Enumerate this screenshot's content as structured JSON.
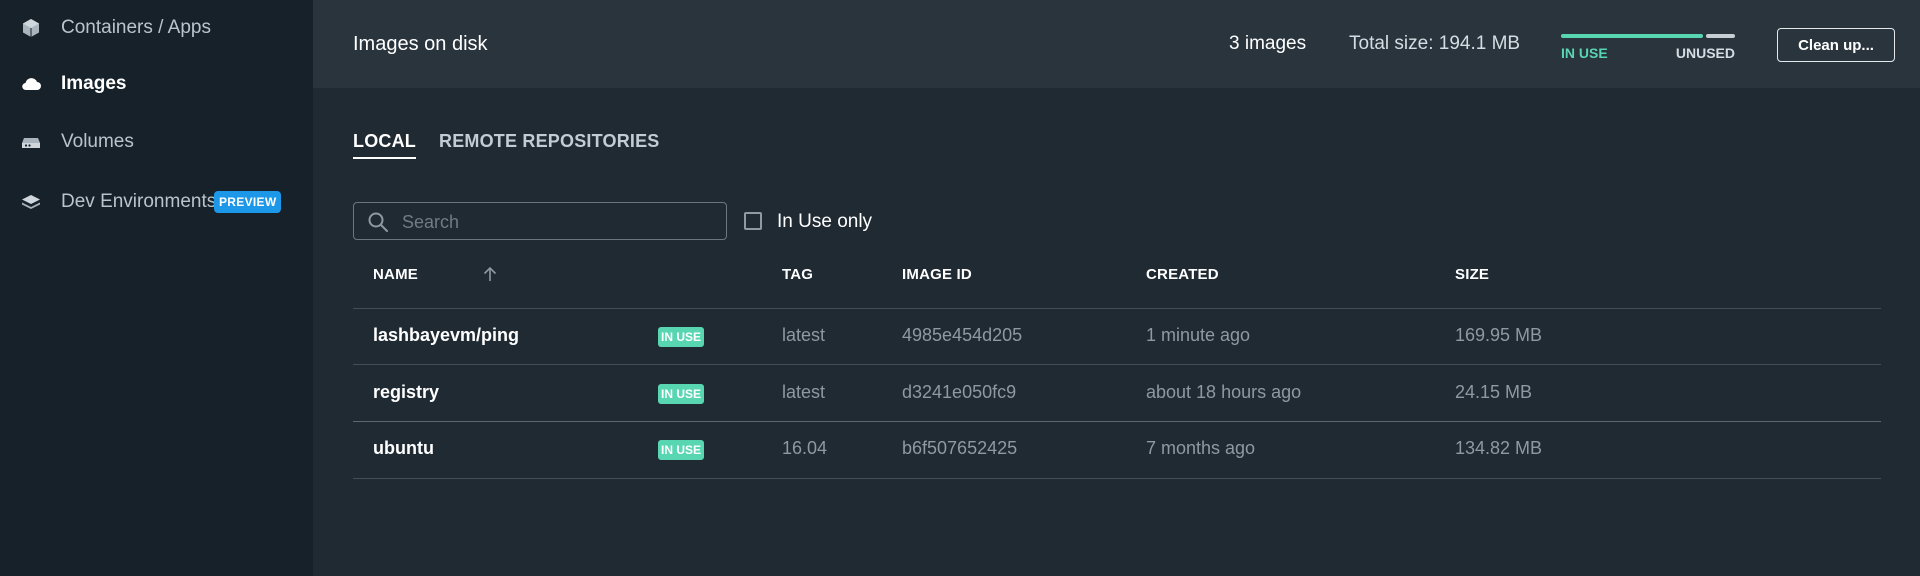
{
  "sidebar": {
    "items": [
      {
        "label": "Containers / Apps",
        "icon": "cube-icon",
        "active": false
      },
      {
        "label": "Images",
        "icon": "cloud-icon",
        "active": true
      },
      {
        "label": "Volumes",
        "icon": "hard-drive-icon",
        "active": false
      },
      {
        "label": "Dev Environments",
        "icon": "layers-icon",
        "active": false,
        "badge": "PREVIEW"
      }
    ]
  },
  "header": {
    "title": "Images on disk",
    "image_count": "3 images",
    "total_size": "Total size: 194.1 MB",
    "usage": {
      "in_use_label": "IN USE",
      "unused_label": "UNUSED",
      "in_use_fraction": 0.83,
      "in_use_color": "#58d5b1",
      "unused_color": "#c7cfd5"
    },
    "cleanup_label": "Clean up..."
  },
  "tabs": [
    {
      "label": "LOCAL",
      "active": true
    },
    {
      "label": "REMOTE REPOSITORIES",
      "active": false
    }
  ],
  "search": {
    "placeholder": "Search",
    "value": ""
  },
  "filter": {
    "label": "In Use only",
    "checked": false
  },
  "table": {
    "columns": [
      "NAME",
      "TAG",
      "IMAGE ID",
      "CREATED",
      "SIZE"
    ],
    "sort": {
      "column": "NAME",
      "direction": "ascending",
      "icon": "arrow-up-icon"
    },
    "rows": [
      {
        "name": "lashbayevm/ping",
        "badge": "IN USE",
        "tag": "latest",
        "image_id": "4985e454d205",
        "created": "1 minute ago",
        "size": "169.95 MB"
      },
      {
        "name": "registry",
        "badge": "IN USE",
        "tag": "latest",
        "image_id": "d3241e050fc9",
        "created": "about 18 hours ago",
        "size": "24.15 MB"
      },
      {
        "name": "ubuntu",
        "badge": "IN USE",
        "tag": "16.04",
        "image_id": "b6f507652425",
        "created": "7 months ago",
        "size": "134.82 MB"
      }
    ]
  },
  "colors": {
    "accent": "#58d5b1",
    "preview_badge": "#1d97e8",
    "sidebar_bg": "#16212a",
    "main_bg": "#202a33",
    "header_bg": "#29343d"
  }
}
